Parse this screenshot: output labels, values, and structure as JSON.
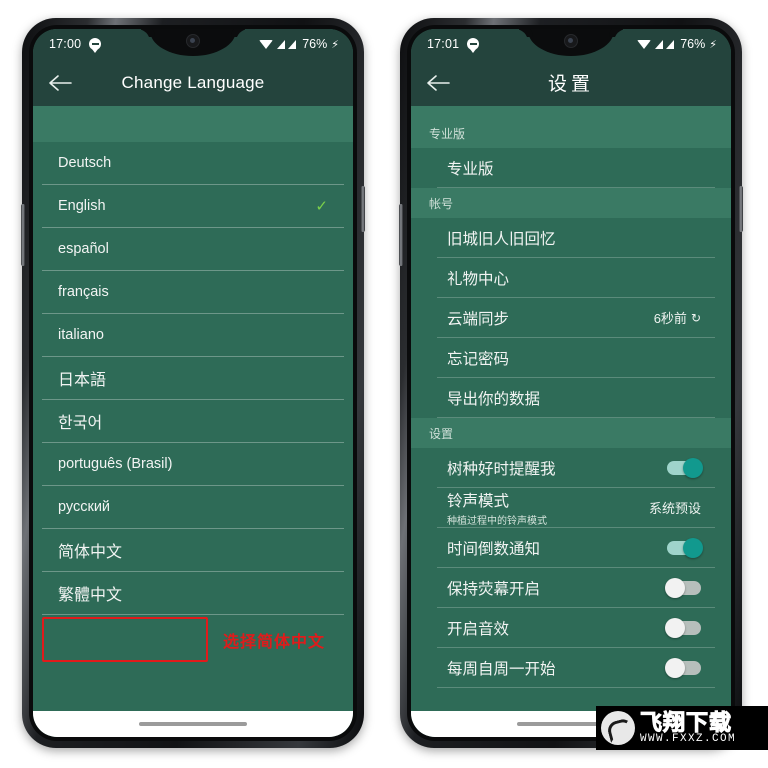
{
  "page": {
    "background_color": "#ffffff",
    "theme_dark_green": "#24443d",
    "theme_green": "#2e6b57",
    "theme_band_green": "#3a7a64",
    "accent_teal": "#11998e",
    "check_green": "#7bd04a",
    "annotation_red": "#e01b1b"
  },
  "left_phone": {
    "statusbar": {
      "clock": "17:00",
      "chat_icon": "chat-bubble-icon",
      "wifi_icon": "wifi-icon",
      "signal_icon_1": "signal-bars-icon",
      "signal_icon_2": "signal-bars-icon",
      "battery": "76%",
      "charging_icon": "lightning-bolt-icon"
    },
    "appbar": {
      "back_icon": "back-arrow-icon",
      "title": "Change Language"
    },
    "languages": [
      {
        "label": "Deutsch",
        "selected": false
      },
      {
        "label": "English",
        "selected": true
      },
      {
        "label": "español",
        "selected": false
      },
      {
        "label": "français",
        "selected": false
      },
      {
        "label": "italiano",
        "selected": false
      },
      {
        "label": "日本語",
        "selected": false
      },
      {
        "label": "한국어",
        "selected": false
      },
      {
        "label": "português (Brasil)",
        "selected": false
      },
      {
        "label": "русский",
        "selected": false
      },
      {
        "label": "简体中文",
        "selected": false
      },
      {
        "label": "繁體中文",
        "selected": false
      }
    ],
    "check_mark": "✓",
    "annotation": {
      "text": "选择简体中文",
      "target_label": "简体中文"
    },
    "navbar": {
      "pill": "home-gesture-pill"
    }
  },
  "right_phone": {
    "statusbar": {
      "clock": "17:01",
      "chat_icon": "chat-bubble-icon",
      "wifi_icon": "wifi-icon",
      "signal_icon_1": "signal-bars-icon",
      "signal_icon_2": "signal-bars-icon",
      "battery": "76%",
      "charging_icon": "lightning-bolt-icon"
    },
    "appbar": {
      "back_icon": "back-arrow-icon",
      "title": "设置"
    },
    "sections": [
      {
        "header": "专业版",
        "rows": [
          {
            "label": "专业版",
            "type": "link"
          }
        ]
      },
      {
        "header": "帐号",
        "rows": [
          {
            "label": "旧城旧人旧回忆",
            "type": "link"
          },
          {
            "label": "礼物中心",
            "type": "link"
          },
          {
            "label": "云端同步",
            "type": "value",
            "value": "6秒前",
            "icon": "sync-refresh-icon"
          },
          {
            "label": "忘记密码",
            "type": "link"
          },
          {
            "label": "导出你的数据",
            "type": "link"
          }
        ]
      },
      {
        "header": "设置",
        "rows": [
          {
            "label": "树种好时提醒我",
            "type": "toggle",
            "on": true
          },
          {
            "label": "铃声模式",
            "sublabel": "种植过程中的铃声模式",
            "type": "value",
            "value": "系统预设"
          },
          {
            "label": "时间倒数通知",
            "type": "toggle",
            "on": true
          },
          {
            "label": "保持荧幕开启",
            "type": "toggle",
            "on": false
          },
          {
            "label": "开启音效",
            "type": "toggle",
            "on": false
          },
          {
            "label": "每周自周一开始",
            "type": "toggle",
            "on": false
          }
        ]
      }
    ],
    "navbar": {
      "pill": "home-gesture-pill"
    }
  },
  "watermark": {
    "main_text": "飞翔下载",
    "sub_text": "WWW.FXXZ.COM",
    "logo": "fxxz-logo-icon"
  }
}
